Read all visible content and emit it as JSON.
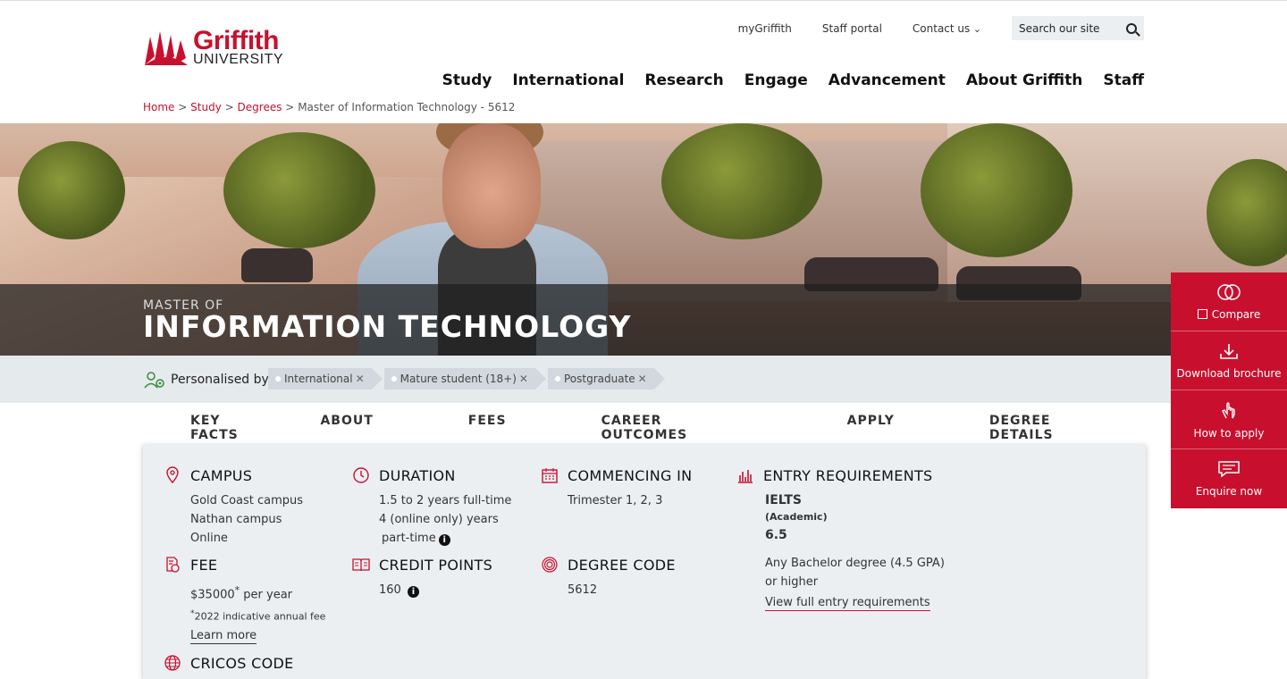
{
  "brand": {
    "line1": "Griffith",
    "line2": "UNIVERSITY",
    "color": "#c8102e"
  },
  "utility_nav": {
    "mygriffith": "myGriffith",
    "staff_portal": "Staff portal",
    "contact": "Contact us",
    "search_placeholder": "Search our site"
  },
  "main_nav": [
    "Study",
    "International",
    "Research",
    "Engage",
    "Advancement",
    "About Griffith",
    "Staff"
  ],
  "breadcrumb": {
    "home": "Home",
    "study": "Study",
    "degrees": "Degrees",
    "current": "Master of Information Technology - 5612",
    "sep": ">"
  },
  "hero": {
    "pre_title": "MASTER OF",
    "title": "INFORMATION TECHNOLOGY"
  },
  "side_panel": {
    "compare": "Compare",
    "download": "Download brochure",
    "apply": "How to apply",
    "enquire": "Enquire now"
  },
  "personalised": {
    "label": "Personalised by",
    "chips": [
      "International",
      "Mature student (18+)",
      "Postgraduate"
    ]
  },
  "tabs": [
    "KEY FACTS",
    "ABOUT",
    "FEES",
    "CAREER OUTCOMES",
    "APPLY",
    "DEGREE DETAILS"
  ],
  "facts": {
    "campus": {
      "title": "CAMPUS",
      "lines": [
        "Gold Coast campus",
        "Nathan campus",
        "Online"
      ]
    },
    "duration": {
      "title": "DURATION",
      "lines": [
        "1.5 to 2 years full-time",
        "4 (online only) years",
        "part-time"
      ]
    },
    "commencing": {
      "title": "COMMENCING IN",
      "lines": [
        "Trimester 1, 2, 3"
      ]
    },
    "entry": {
      "title": "ENTRY REQUIREMENTS",
      "test": "IELTS",
      "test_sub": "(Academic)",
      "score": "6.5",
      "req_line1": "Any Bachelor degree (4.5 GPA)",
      "req_line2": "or higher",
      "link": "View full entry requirements"
    },
    "fee": {
      "title": "FEE",
      "amount": "$35000",
      "star": "*",
      "per": "per year",
      "note": "2022 indicative annual fee",
      "link": "Learn more"
    },
    "credit": {
      "title": "CREDIT POINTS",
      "value": "160"
    },
    "degree_code": {
      "title": "DEGREE CODE",
      "value": "5612"
    },
    "cricos": {
      "title": "CRICOS CODE"
    }
  }
}
